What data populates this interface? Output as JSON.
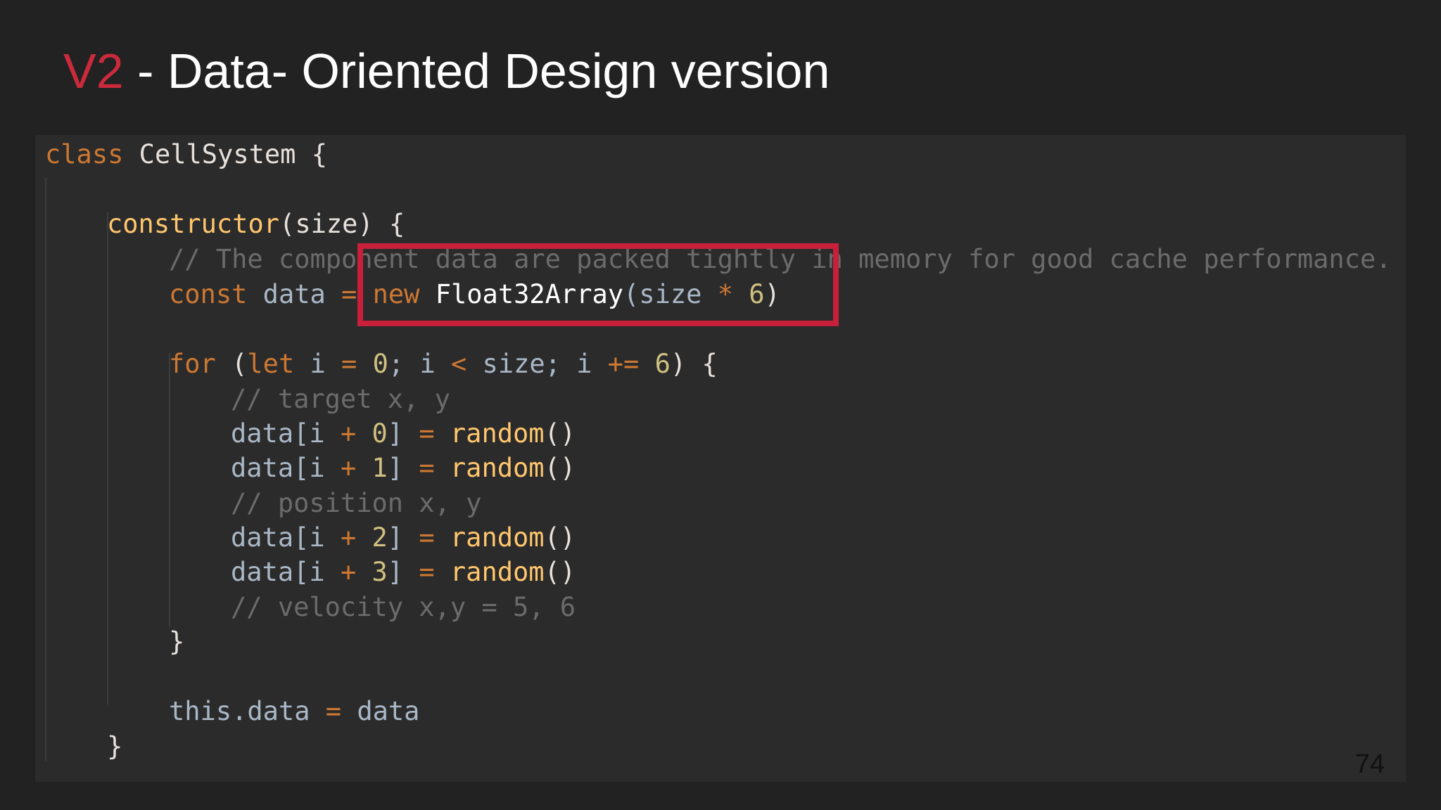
{
  "slide": {
    "title_accent": "V2",
    "title_rest": " - Data- Oriented Design version",
    "page_number": "74",
    "accent_color": "#cc2a3c",
    "highlight_color": "#c8203a"
  },
  "code": {
    "l1": {
      "kw": "class",
      "name": " CellSystem {"
    },
    "l3": {
      "fn": "constructor",
      "rest": "(size) {"
    },
    "l4": {
      "comment": "// The component data are packed tightly in memory for good cache performance."
    },
    "l5": {
      "kw": "const",
      "id": " data ",
      "op": "=",
      "kw2": " new",
      "cls": " Float32Array",
      "rest1": "(size ",
      "op2": "*",
      "num": " 6",
      "rest2": ")"
    },
    "l7": {
      "kw": "for",
      "p1": " (",
      "kw2": "let",
      "p2": " i ",
      "op": "=",
      "num": " 0",
      "p3": "; i ",
      "op2": "<",
      "p4": " size; i ",
      "op3": "+=",
      "num2": " 6",
      "p5": ") {"
    },
    "l8": {
      "comment": "// target x, y"
    },
    "l9": {
      "id": "data[i ",
      "op": "+",
      "num": " 0",
      "p": "] ",
      "op2": "=",
      "fn": " random",
      "p2": "()"
    },
    "l10": {
      "id": "data[i ",
      "op": "+",
      "num": " 1",
      "p": "] ",
      "op2": "=",
      "fn": " random",
      "p2": "()"
    },
    "l11": {
      "comment": "// position x, y"
    },
    "l12": {
      "id": "data[i ",
      "op": "+",
      "num": " 2",
      "p": "] ",
      "op2": "=",
      "fn": " random",
      "p2": "()"
    },
    "l13": {
      "id": "data[i ",
      "op": "+",
      "num": " 3",
      "p": "] ",
      "op2": "=",
      "fn": " random",
      "p2": "()"
    },
    "l14": {
      "comment": "// velocity x,y = 5, 6"
    },
    "l15": {
      "text": "}"
    },
    "l17": {
      "id": "this.data ",
      "op": "=",
      "id2": " data"
    },
    "l18": {
      "text": "}"
    }
  }
}
